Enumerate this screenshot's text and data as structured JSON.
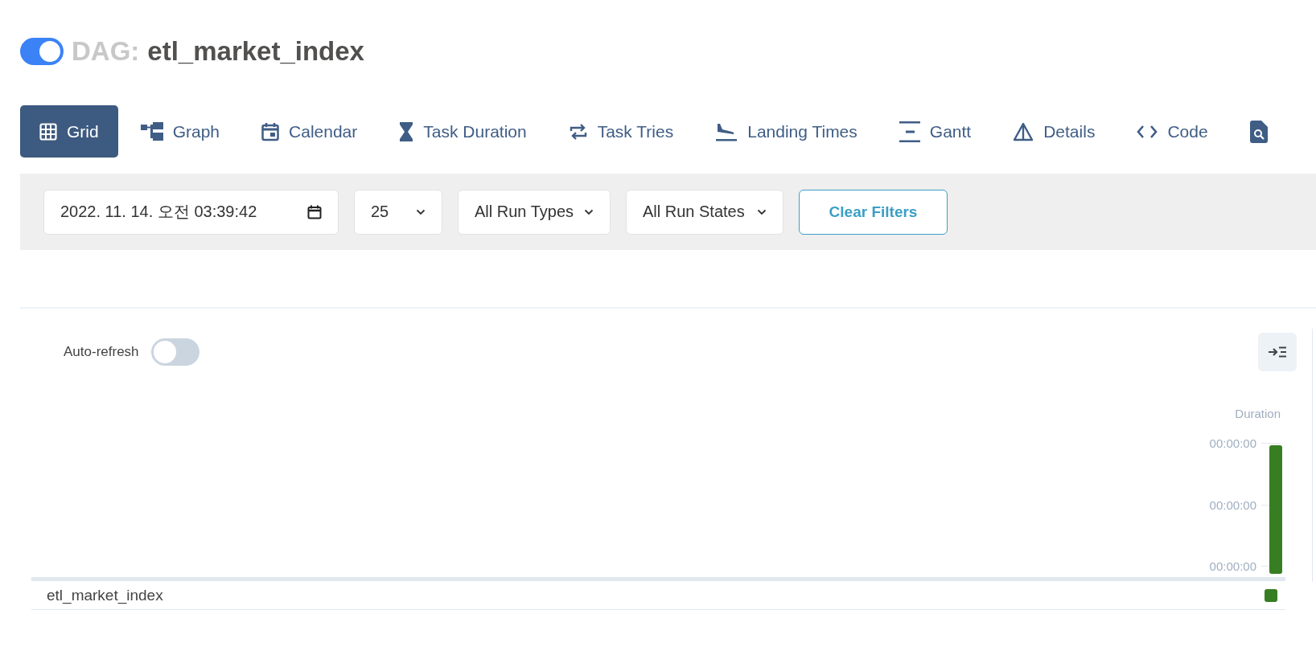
{
  "dag": {
    "prefix": "DAG:",
    "name": "etl_market_index",
    "on": true
  },
  "tabs": [
    {
      "kind": "grid",
      "label": "Grid",
      "selected": true
    },
    {
      "kind": "graph",
      "label": "Graph",
      "selected": false
    },
    {
      "kind": "calendar",
      "label": "Calendar",
      "selected": false
    },
    {
      "kind": "duration",
      "label": "Task Duration",
      "selected": false
    },
    {
      "kind": "tries",
      "label": "Task Tries",
      "selected": false
    },
    {
      "kind": "landing",
      "label": "Landing Times",
      "selected": false
    },
    {
      "kind": "gantt",
      "label": "Gantt",
      "selected": false
    },
    {
      "kind": "details",
      "label": "Details",
      "selected": false
    },
    {
      "kind": "code",
      "label": "Code",
      "selected": false
    },
    {
      "kind": "audit",
      "selected": false
    }
  ],
  "filters": {
    "date": "2022. 11. 14. 오전 03:39:42",
    "limit": "25",
    "run_type": "All Run Types",
    "run_state": "All Run States",
    "clear_button": "Clear Filters"
  },
  "grid": {
    "auto_refresh": {
      "label": "Auto-refresh",
      "on": false
    },
    "duration": {
      "title": "Duration",
      "ticks": [
        "00:00:00",
        "00:00:00",
        "00:00:00"
      ]
    },
    "runs": [
      {
        "color": "#377e22"
      }
    ],
    "tasks": [
      {
        "name": "etl_market_index",
        "instances": [
          {
            "color": "#377e22"
          }
        ]
      }
    ]
  }
}
